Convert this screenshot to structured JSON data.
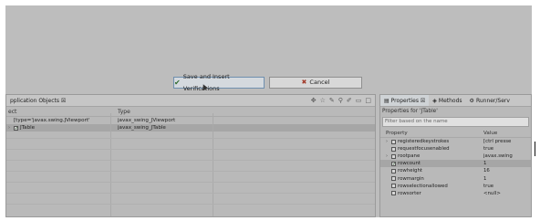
{
  "dialog": {
    "save_label": "Save and Insert Verifications",
    "cancel_label": "Cancel"
  },
  "left_panel": {
    "title": "pplication Objects ☒",
    "columns": [
      "ect",
      "Type"
    ],
    "rows": [
      {
        "name": "[type='javax.swing.JViewport'",
        "type": "javax_swing_JViewport",
        "expand": "",
        "checked": false
      },
      {
        "name": "JTable",
        "type": "javax_swing_JTable",
        "expand": "›",
        "checked": true
      }
    ]
  },
  "right_panel": {
    "tabs": [
      "Properties ☒",
      "Methods",
      "Runner/Serv"
    ],
    "subtitle": "Properties for 'JTable'",
    "filter_placeholder": "Filter based on the name",
    "columns": [
      "Property",
      "Value"
    ],
    "rows": [
      {
        "expand": "›",
        "checked": false,
        "name": "registeredkeystrokes",
        "value": "[ctrl presse"
      },
      {
        "expand": "",
        "checked": false,
        "name": "requestfocusenabled",
        "value": "true"
      },
      {
        "expand": "›",
        "checked": false,
        "name": "rootpane",
        "value": "javax.swing"
      },
      {
        "expand": "",
        "checked": true,
        "name": "rowcount",
        "value": "1"
      },
      {
        "expand": "",
        "checked": false,
        "name": "rowheight",
        "value": "16"
      },
      {
        "expand": "",
        "checked": false,
        "name": "rowmargin",
        "value": "1"
      },
      {
        "expand": "",
        "checked": false,
        "name": "rowselectionallowed",
        "value": "true"
      },
      {
        "expand": "",
        "checked": false,
        "name": "rowsorter",
        "value": "<null>"
      }
    ]
  }
}
